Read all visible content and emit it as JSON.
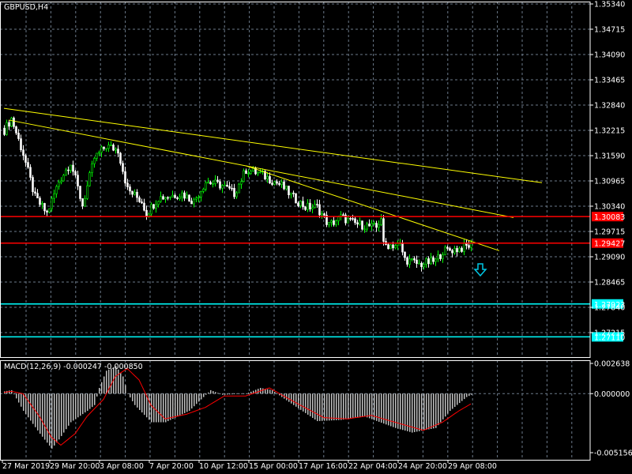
{
  "chart_data": {
    "type": "candlestick",
    "title": "GBPUSD,H4",
    "symbol": "GBPUSD",
    "timeframe": "H4",
    "bar_count": 198,
    "price_axis": {
      "ticks": [
        "1.35340",
        "1.34715",
        "1.34090",
        "1.33465",
        "1.32840",
        "1.32215",
        "1.31590",
        "1.30965",
        "1.30340",
        "1.29715",
        "1.29090",
        "1.28465",
        "1.27840",
        "1.27215"
      ],
      "range": [
        1.2672,
        1.3534
      ]
    },
    "time_axis": {
      "labels": [
        "27 Mar 2019",
        "29 Mar 20:00",
        "3 Apr 08:00",
        "7 Apr 20:00",
        "10 Apr 12:00",
        "15 Apr 00:00",
        "17 Apr 16:00",
        "22 Apr 04:00",
        "24 Apr 20:00",
        "29 Apr 08:00"
      ],
      "label_bars": [
        0,
        20,
        41,
        62,
        83,
        104,
        125,
        146,
        167,
        188
      ]
    },
    "close_keypoints": [
      [
        0,
        1.3222
      ],
      [
        3,
        1.3251
      ],
      [
        8,
        1.3163
      ],
      [
        13,
        1.3055
      ],
      [
        18,
        1.3016
      ],
      [
        23,
        1.3095
      ],
      [
        28,
        1.3143
      ],
      [
        33,
        1.3036
      ],
      [
        38,
        1.3153
      ],
      [
        43,
        1.3183
      ],
      [
        48,
        1.3173
      ],
      [
        52,
        1.3075
      ],
      [
        58,
        1.3046
      ],
      [
        60,
        1.3016
      ],
      [
        65,
        1.3055
      ],
      [
        75,
        1.3065
      ],
      [
        80,
        1.3046
      ],
      [
        85,
        1.3095
      ],
      [
        92,
        1.3085
      ],
      [
        97,
        1.3065
      ],
      [
        102,
        1.3124
      ],
      [
        108,
        1.3114
      ],
      [
        117,
        1.3085
      ],
      [
        122,
        1.3055
      ],
      [
        127,
        1.3032
      ],
      [
        132,
        1.3032
      ],
      [
        137,
        1.2987
      ],
      [
        142,
        1.3007
      ],
      [
        148,
        1.2991
      ],
      [
        157,
        1.2981
      ],
      [
        159,
        1.3007
      ],
      [
        160,
        1.2938
      ],
      [
        167,
        1.2938
      ],
      [
        169,
        1.2903
      ],
      [
        175,
        1.289
      ],
      [
        182,
        1.2899
      ],
      [
        185,
        1.2923
      ],
      [
        192,
        1.2929
      ],
      [
        197,
        1.2938
      ]
    ],
    "horizontal_lines": [
      {
        "price": "1.30083",
        "color": "#ff0000"
      },
      {
        "price": "1.29427",
        "color": "#ff0000"
      },
      {
        "price": "1.27923",
        "color": "#00ffff"
      },
      {
        "price": "1.27110",
        "color": "#00ffff"
      }
    ],
    "trendlines": [
      {
        "from": [
          0,
          1.3276
        ],
        "to": [
          227,
          1.3092
        ],
        "color": "#ffff00"
      },
      {
        "from": [
          2,
          1.3247
        ],
        "to": [
          215,
          1.3006
        ],
        "color": "#ffff00"
      },
      {
        "from": [
          102,
          1.3134
        ],
        "to": [
          209,
          1.2924
        ],
        "color": "#ffff00"
      }
    ],
    "arrow_down": {
      "bar": 201,
      "price": 1.2868,
      "color": "#00c8e6"
    },
    "macd": {
      "label": "MACD(12,26,9) -0.000247 -0.000850",
      "ticks": [
        "0.002638",
        "0.000000",
        "-0.005156"
      ],
      "range": [
        -0.005156,
        0.002638
      ],
      "histogram_keypoints": [
        [
          0,
          0.0002
        ],
        [
          3,
          0.0003
        ],
        [
          8,
          -0.0015
        ],
        [
          15,
          -0.0035
        ],
        [
          20,
          -0.0048
        ],
        [
          23,
          -0.004
        ],
        [
          28,
          -0.0025
        ],
        [
          35,
          -0.0015
        ],
        [
          38,
          -0.001
        ],
        [
          40,
          0.0005
        ],
        [
          43,
          0.002
        ],
        [
          47,
          0.0024
        ],
        [
          50,
          0.0015
        ],
        [
          52,
          0
        ],
        [
          55,
          -0.001
        ],
        [
          62,
          -0.0025
        ],
        [
          68,
          -0.0025
        ],
        [
          78,
          -0.0015
        ],
        [
          83,
          -0.0005
        ],
        [
          87,
          0.0003
        ],
        [
          92,
          -0.0001
        ],
        [
          102,
          0
        ],
        [
          108,
          0.0005
        ],
        [
          113,
          0.0003
        ],
        [
          117,
          -0.0003
        ],
        [
          122,
          -0.001
        ],
        [
          132,
          -0.0024
        ],
        [
          142,
          -0.0023
        ],
        [
          152,
          -0.002
        ],
        [
          165,
          -0.003
        ],
        [
          172,
          -0.0034
        ],
        [
          182,
          -0.003
        ],
        [
          188,
          -0.0015
        ],
        [
          195,
          -0.0003
        ],
        [
          197,
          -0.0001
        ]
      ],
      "signal_keypoints": [
        [
          0,
          0.0001
        ],
        [
          3,
          0.0002
        ],
        [
          8,
          0
        ],
        [
          15,
          -0.002
        ],
        [
          20,
          -0.0038
        ],
        [
          24,
          -0.0045
        ],
        [
          30,
          -0.0035
        ],
        [
          35,
          -0.002
        ],
        [
          42,
          -0.0005
        ],
        [
          47,
          0.0015
        ],
        [
          52,
          0.0022
        ],
        [
          57,
          0.0012
        ],
        [
          62,
          -0.001
        ],
        [
          68,
          -0.0022
        ],
        [
          77,
          -0.0018
        ],
        [
          85,
          -0.0012
        ],
        [
          93,
          -0.0002
        ],
        [
          102,
          -0.0002
        ],
        [
          112,
          0.0005
        ],
        [
          118,
          -0.0002
        ],
        [
          125,
          -0.001
        ],
        [
          135,
          -0.0021
        ],
        [
          145,
          -0.0022
        ],
        [
          155,
          -0.0019
        ],
        [
          165,
          -0.0025
        ],
        [
          177,
          -0.0032
        ],
        [
          185,
          -0.0025
        ],
        [
          192,
          -0.0015
        ],
        [
          197,
          -0.0009
        ]
      ],
      "hist_color": "#c0c0c0",
      "signal_color": "#ff0000"
    },
    "colors": {
      "bull": "#00ff00",
      "bear": "#ffffff",
      "grid": "#6c7a8a",
      "axis": "#ffffff"
    }
  }
}
